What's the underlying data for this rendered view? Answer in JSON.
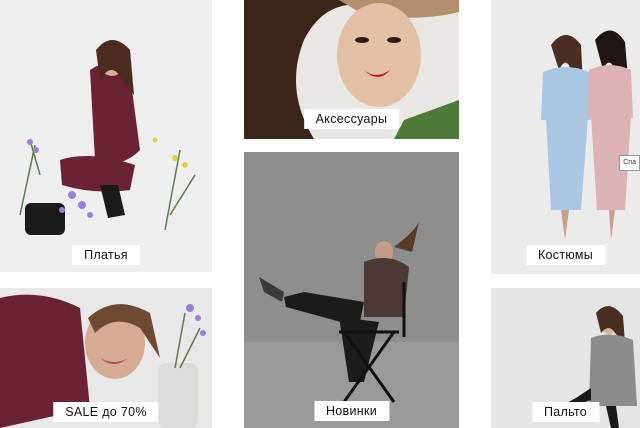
{
  "categories": [
    {
      "id": "dresses",
      "label": "Платья"
    },
    {
      "id": "accessories",
      "label": "Аксессуары"
    },
    {
      "id": "suits",
      "label": "Костюмы"
    },
    {
      "id": "sale",
      "label": "SALE до 70%"
    },
    {
      "id": "new",
      "label": "Новинки"
    },
    {
      "id": "coats",
      "label": "Пальто"
    }
  ],
  "tooltip": {
    "text": "Спа"
  },
  "colors": {
    "label_bg": "#ffffff",
    "label_text": "#111111",
    "page_bg": "#ffffff"
  }
}
